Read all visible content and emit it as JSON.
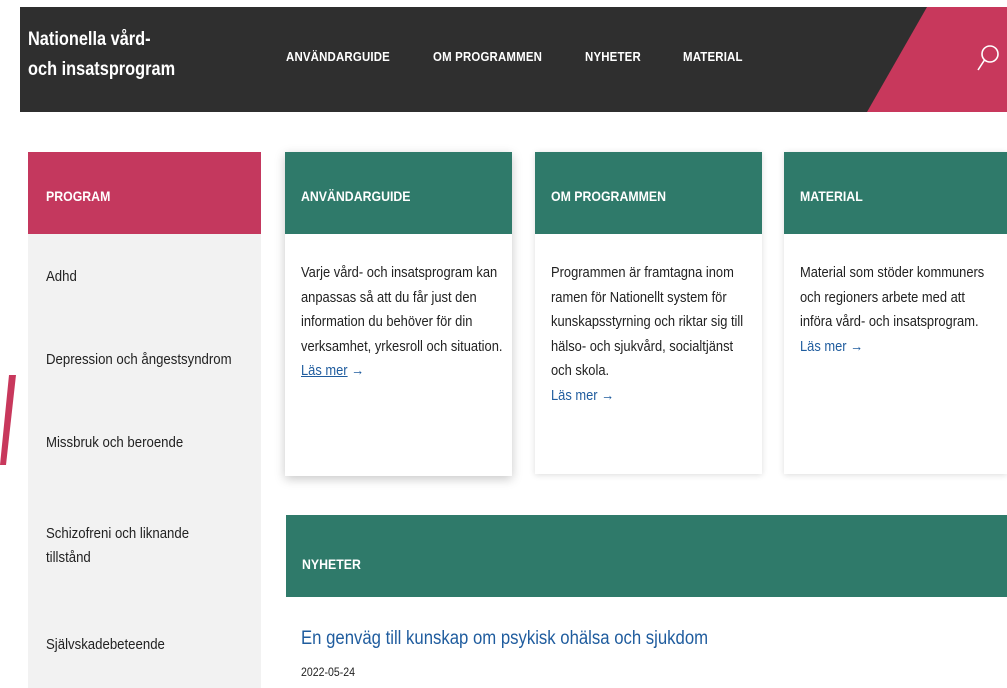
{
  "header": {
    "brand_line1": "Nationella vård-",
    "brand_line2": "och insatsprogram",
    "nav": [
      "ANVÄNDARGUIDE",
      "OM PROGRAMMEN",
      "NYHETER",
      "MATERIAL"
    ],
    "accent_color": "#c8385c",
    "search_icon": "search-icon"
  },
  "sidebar": {
    "heading": "PROGRAM",
    "items": [
      "Adhd",
      "Depression och ångestsyndrom",
      "Missbruk och beroende",
      "Schizofreni och liknande tillstånd",
      "Självskadebeteende"
    ]
  },
  "cards": [
    {
      "heading": "ANVÄNDARGUIDE",
      "text": "Varje vård- och insatsprogram kan anpassas så att du får just den information du behöver för din verksamhet, yrkesroll och situation.",
      "link": "Läs mer",
      "arrow": "→"
    },
    {
      "heading": "OM PROGRAMMEN",
      "text": "Programmen är framtagna inom ramen för Nationellt system för kunskapsstyrning och riktar sig till hälso- och sjukvård, socialtjänst och skola.",
      "link": "Läs mer",
      "arrow": "→"
    },
    {
      "heading": "MATERIAL",
      "text": "Material som stöder kommuners och regioners arbete med att införa vård- och insatsprogram.",
      "link": "Läs mer",
      "arrow": "→"
    }
  ],
  "news": {
    "heading": "NYHETER",
    "items": [
      {
        "title": "En genväg till kunskap om psykisk ohälsa och sjukdom",
        "date": "2022-05-24"
      }
    ]
  },
  "colors": {
    "topbar": "#2f2f2f",
    "sidebar_head": "#c4385e",
    "teal": "#2f7a6a",
    "link": "#1f5c9e"
  }
}
